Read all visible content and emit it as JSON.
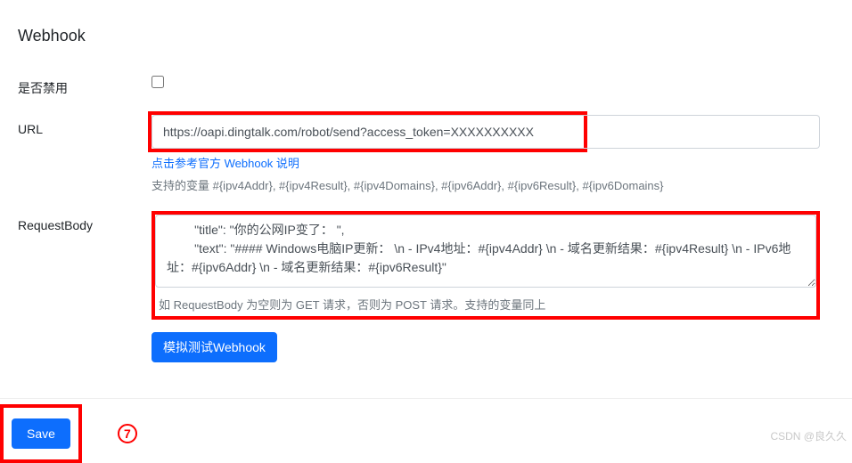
{
  "section": {
    "title": "Webhook"
  },
  "disable": {
    "label": "是否禁用"
  },
  "url": {
    "label": "URL",
    "value": "https://oapi.dingtalk.com/robot/send?access_token=XXXXXXXXXX",
    "help_link": "点击参考官方 Webhook 说明",
    "help_text": "支持的变量 #{ipv4Addr}, #{ipv4Result}, #{ipv4Domains}, #{ipv6Addr}, #{ipv6Result}, #{ipv6Domains}"
  },
  "body": {
    "label": "RequestBody",
    "value": "        \"title\": \"你的公网IP变了： \",\n        \"text\": \"#### Windows电脑IP更新： \\n - IPv4地址：#{ipv4Addr} \\n - 域名更新结果：#{ipv4Result} \\n - IPv6地址：#{ipv6Addr} \\n - 域名更新结果：#{ipv6Result}\"",
    "help_text": "如 RequestBody 为空则为 GET 请求，否则为 POST 请求。支持的变量同上"
  },
  "test_button": {
    "label": "模拟测试Webhook"
  },
  "save_button": {
    "label": "Save"
  },
  "annotation": {
    "step": "7"
  },
  "watermark": "CSDN @良久久"
}
